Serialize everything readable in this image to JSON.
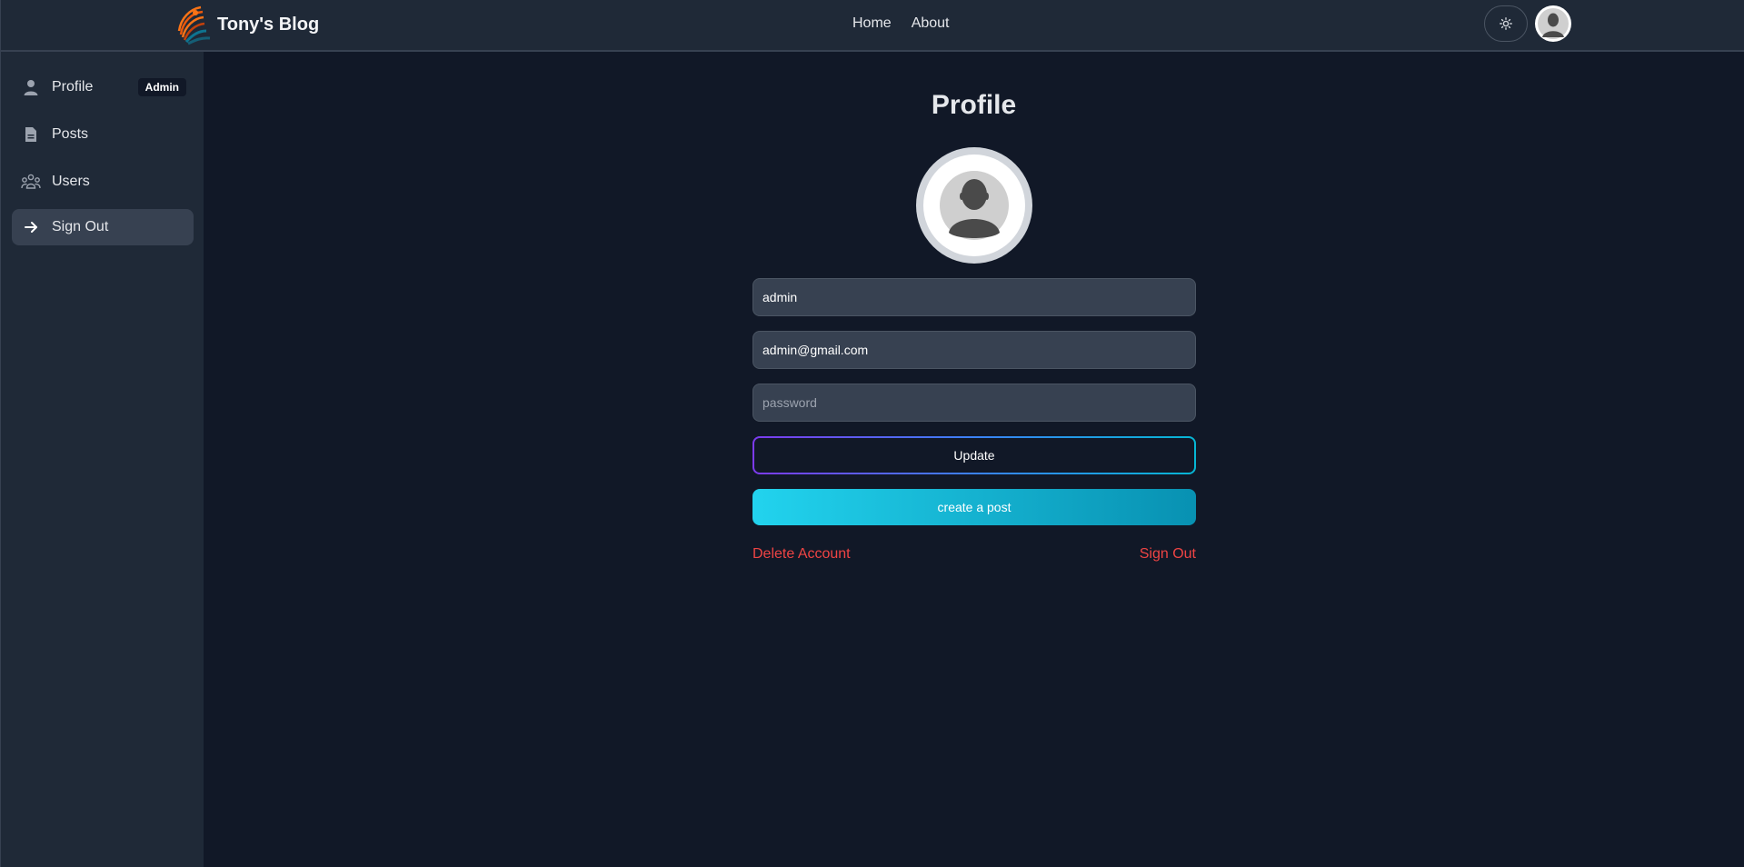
{
  "colors": {
    "background": "#111827",
    "panel": "#1f2937",
    "accent_gradient_start": "#7c3aed",
    "accent_gradient_end": "#06b6d4",
    "cyan_start": "#22d3ee",
    "cyan_end": "#0891b2",
    "danger": "#ef4444"
  },
  "header": {
    "brand_title": "Tony's Blog",
    "logo_icon": "fan-logo-icon",
    "nav": [
      {
        "label": "Home"
      },
      {
        "label": "About"
      }
    ],
    "theme_icon": "sun-icon",
    "avatar_icon": "user-avatar-icon"
  },
  "sidebar": {
    "items": [
      {
        "label": "Profile",
        "icon": "user-icon",
        "badge": "Admin"
      },
      {
        "label": "Posts",
        "icon": "document-icon"
      },
      {
        "label": "Users",
        "icon": "users-group-icon"
      },
      {
        "label": "Sign Out",
        "icon": "arrow-right-icon",
        "active": true
      }
    ]
  },
  "main": {
    "title": "Profile",
    "username_value": "admin",
    "email_value": "admin@gmail.com",
    "password_placeholder": "password",
    "update_label": "Update",
    "create_post_label": "create a post",
    "delete_account_label": "Delete Account",
    "sign_out_label": "Sign Out"
  }
}
